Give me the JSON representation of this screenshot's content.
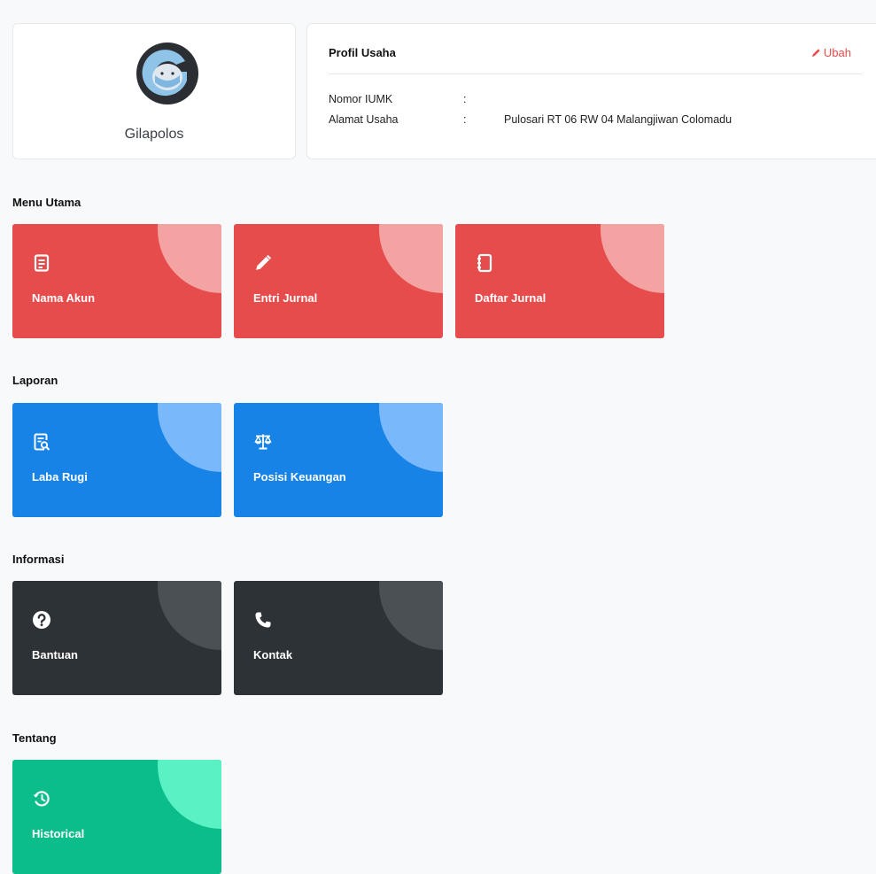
{
  "user": {
    "name": "Gilapolos",
    "avatar_letter": "G"
  },
  "profile": {
    "title": "Profil Usaha",
    "edit_label": "Ubah",
    "fields": [
      {
        "label": "Nomor IUMK",
        "separator": ":",
        "value": ""
      },
      {
        "label": "Alamat Usaha",
        "separator": ":",
        "value": "Pulosari RT 06 RW 04 Malangjiwan Colomadu"
      }
    ]
  },
  "sections": [
    {
      "title": "Menu Utama",
      "tiles": [
        {
          "label": "Nama Akun",
          "icon": "document-icon"
        },
        {
          "label": "Entri Jurnal",
          "icon": "pencil-icon"
        },
        {
          "label": "Daftar Jurnal",
          "icon": "journal-icon"
        }
      ]
    },
    {
      "title": "Laporan",
      "tiles": [
        {
          "label": "Laba Rugi",
          "icon": "report-search-icon"
        },
        {
          "label": "Posisi Keuangan",
          "icon": "balance-scale-icon"
        }
      ]
    },
    {
      "title": "Informasi",
      "tiles": [
        {
          "label": "Bantuan",
          "icon": "question-circle-icon"
        },
        {
          "label": "Kontak",
          "icon": "phone-icon"
        }
      ]
    },
    {
      "title": "Tentang",
      "tiles": [
        {
          "label": "Historical",
          "icon": "history-icon"
        }
      ]
    }
  ],
  "colors": {
    "menu_utama": "#e74c4c",
    "laporan": "#1783e6",
    "informasi": "#2d3236",
    "tentang": "#0bbd8b",
    "accent": "#e74c4c"
  }
}
